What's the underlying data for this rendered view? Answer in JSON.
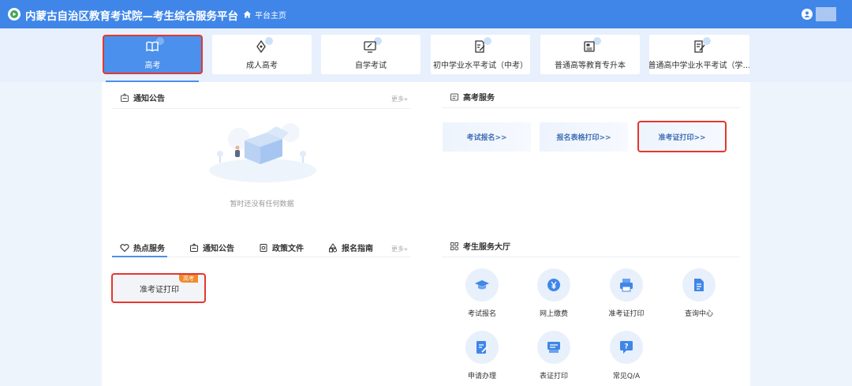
{
  "header": {
    "title": "内蒙古自治区教育考试院—考生综合服务平台",
    "home_label": "平台主页",
    "brand_color": "#3f86e8"
  },
  "tabs": [
    {
      "label": "高考",
      "icon": "book-icon",
      "active": true
    },
    {
      "label": "成人高考",
      "icon": "pen-nib-icon",
      "active": false
    },
    {
      "label": "自学考试",
      "icon": "monitor-edit-icon",
      "active": false
    },
    {
      "label": "初中学业水平考试（中考）",
      "icon": "document-edit-icon",
      "active": false
    },
    {
      "label": "普通高等教育专升本",
      "icon": "newspaper-icon",
      "active": false
    },
    {
      "label": "普通高中学业水平考试（学…",
      "icon": "document-pencil-icon",
      "active": false
    }
  ],
  "notice": {
    "title": "通知公告",
    "more": "更多»",
    "empty_text": "暂时还没有任何数据"
  },
  "gaokao_services": {
    "title": "高考服务",
    "cards": [
      "考试报名>>",
      "报名表格打印>>",
      "准考证打印>>"
    ]
  },
  "hot": {
    "tabs": [
      "热点服务",
      "通知公告",
      "政策文件",
      "报名指南"
    ],
    "more": "更多»",
    "item_label": "准考证打印",
    "item_badge": "高考"
  },
  "hall": {
    "title": "考生服务大厅",
    "items": [
      {
        "label": "考试报名",
        "icon": "graduation-cap-icon"
      },
      {
        "label": "网上缴费",
        "icon": "yuan-coin-icon"
      },
      {
        "label": "准考证打印",
        "icon": "printer-icon"
      },
      {
        "label": "查询中心",
        "icon": "document-search-icon"
      },
      {
        "label": "申请办理",
        "icon": "form-edit-icon"
      },
      {
        "label": "表证打印",
        "icon": "card-print-icon"
      },
      {
        "label": "常见Q/A",
        "icon": "question-chat-icon"
      }
    ]
  },
  "highlight_color": "#e5372e"
}
